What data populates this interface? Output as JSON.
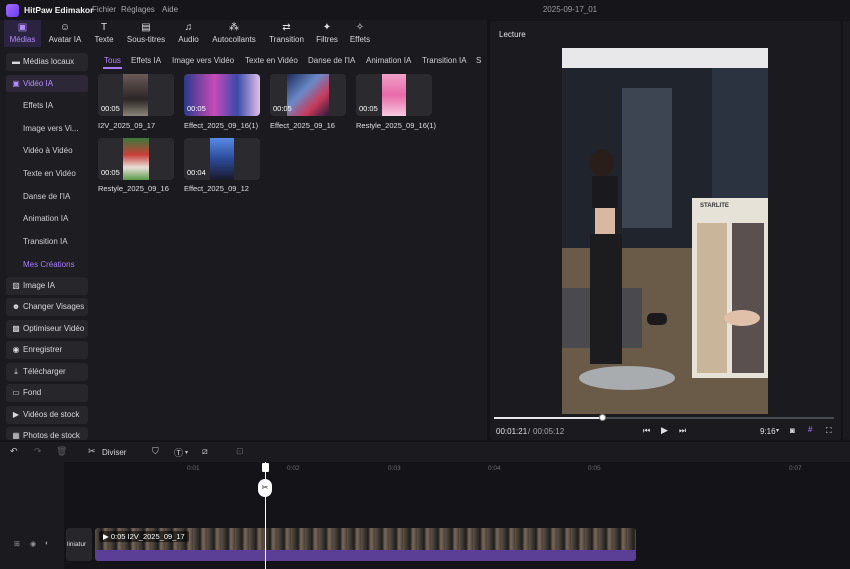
{
  "titlebar": {
    "app_name": "HitPaw Edimakor",
    "menus": [
      "Fichier",
      "Réglages",
      "Aide"
    ],
    "project_name": "2025-09-17_01"
  },
  "toolbar": [
    {
      "label": "Médias",
      "icon": "media-icon"
    },
    {
      "label": "Avatar IA",
      "icon": "avatar-icon"
    },
    {
      "label": "Texte",
      "icon": "text-icon"
    },
    {
      "label": "Sous-titres",
      "icon": "subtitles-icon"
    },
    {
      "label": "Audio",
      "icon": "audio-icon"
    },
    {
      "label": "Autocollants",
      "icon": "stickers-icon"
    },
    {
      "label": "Transition",
      "icon": "transition-icon"
    },
    {
      "label": "Filtres",
      "icon": "filters-icon"
    },
    {
      "label": "Effets",
      "icon": "effects-icon"
    }
  ],
  "leftnav": {
    "local_media": "Médias locaux",
    "ai_video": "Vidéo IA",
    "sub_items": [
      "Effets IA",
      "Image vers Vi...",
      "Vidéo à Vidéo",
      "Texte en Vidéo",
      "Danse de l'IA",
      "Animation IA",
      "Transition IA",
      "Mes Créations"
    ],
    "bottom_items": [
      "Image IA",
      "Changer Visages",
      "Optimiseur Vidéo",
      "Enregistrer",
      "Télécharger",
      "Fond",
      "Vidéos de stock",
      "Photos de stock"
    ]
  },
  "media_tabs": [
    "Tous",
    "Effets IA",
    "Image vers Vidéo",
    "Texte en Vidéo",
    "Danse de l'IA",
    "Animation IA",
    "Transition IA",
    "S"
  ],
  "media_items": [
    {
      "name": "I2V_2025_09_17",
      "duration": "00:05"
    },
    {
      "name": "Effect_2025_09_16(1)",
      "duration": "00:05"
    },
    {
      "name": "Effect_2025_09_16",
      "duration": "00:05"
    },
    {
      "name": "Restyle_2025_09_16(1)",
      "duration": "00:05"
    },
    {
      "name": "Restyle_2025_09_16",
      "duration": "00:05"
    },
    {
      "name": "Effect_2025_09_12",
      "duration": "00:04"
    }
  ],
  "preview": {
    "title": "Lecture",
    "current_time": "00:01:21",
    "total_time": "00:05:12",
    "aspect": "9:16",
    "progress": 0.32
  },
  "timeline": {
    "split_label": "Diviser",
    "ruler": [
      "0:01",
      "0:02",
      "0:03",
      "0:04",
      "0:05",
      "0:07"
    ],
    "clip_label": "0:05 I2V_2025_09_17",
    "cover_label": "liniatur"
  },
  "video_box_text": "STARLITE"
}
